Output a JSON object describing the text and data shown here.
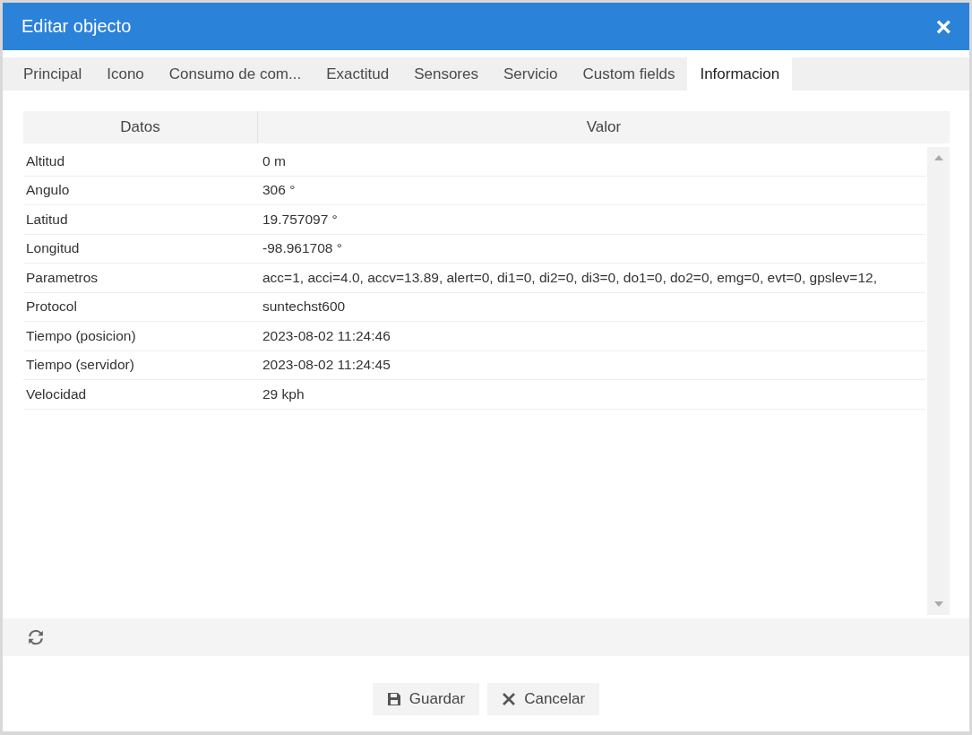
{
  "window": {
    "title": "Editar objecto",
    "close": "×"
  },
  "tabs": [
    {
      "label": "Principal",
      "selected": false
    },
    {
      "label": "Icono",
      "selected": false
    },
    {
      "label": "Consumo de com...",
      "selected": false
    },
    {
      "label": "Exactitud",
      "selected": false
    },
    {
      "label": "Sensores",
      "selected": false
    },
    {
      "label": "Servicio",
      "selected": false
    },
    {
      "label": "Custom fields",
      "selected": false
    },
    {
      "label": "Informacion",
      "selected": true
    }
  ],
  "table": {
    "columns": [
      "Datos",
      "Valor"
    ],
    "rows": [
      [
        "Altitud",
        "0 m"
      ],
      [
        "Angulo",
        "306 °"
      ],
      [
        "Latitud",
        "19.757097 °"
      ],
      [
        "Longitud",
        "-98.961708 °"
      ],
      [
        "Parametros",
        "acc=1, acci=4.0, accv=13.89, alert=0, di1=0, di2=0, di3=0, do1=0, do2=0, emg=0, evt=0, gpslev=12,"
      ],
      [
        "Protocol",
        "suntechst600"
      ],
      [
        "Tiempo (posicion)",
        "2023-08-02 11:24:46"
      ],
      [
        "Tiempo (servidor)",
        "2023-08-02 11:24:45"
      ],
      [
        "Velocidad",
        "29 kph"
      ]
    ]
  },
  "buttons": [
    {
      "kind": "save",
      "label": "Guardar"
    },
    {
      "kind": "cancel",
      "label": "Cancelar"
    }
  ]
}
